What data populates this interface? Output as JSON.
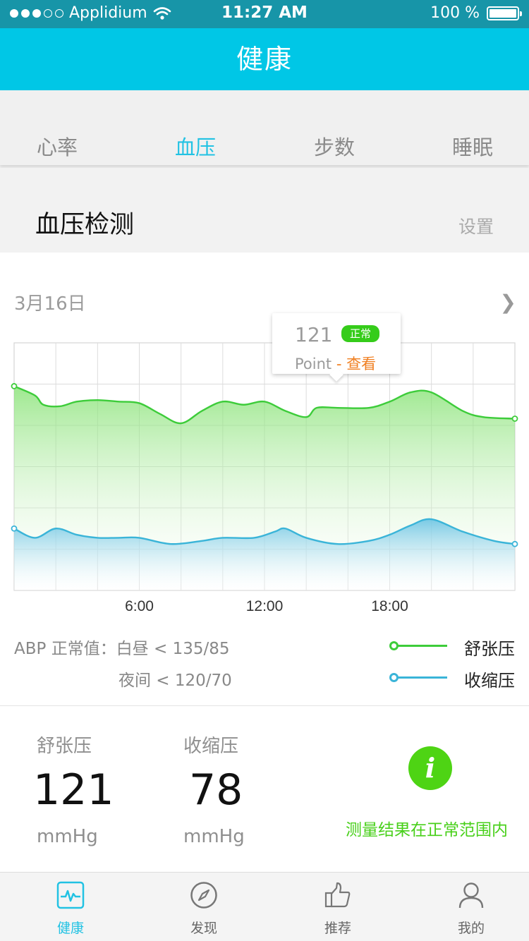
{
  "status_bar": {
    "carrier": "Applidium",
    "time": "11:27 AM",
    "battery": "100 %"
  },
  "nav": {
    "title": "健康"
  },
  "tabs": [
    {
      "label": "心率",
      "active": false
    },
    {
      "label": "血压",
      "active": true
    },
    {
      "label": "步数",
      "active": false
    },
    {
      "label": "睡眠",
      "active": false
    }
  ],
  "section": {
    "title": "血压检测",
    "settings_label": "设置"
  },
  "chart_card": {
    "date": "3月16日",
    "tooltip": {
      "value": "121",
      "badge": "正常",
      "label": "Point",
      "separator": "-",
      "link": "查看"
    }
  },
  "legend": {
    "abp_line1": "ABP 正常值：白昼 < 135/85",
    "abp_line2": "夜间 < 120/70",
    "diastolic": "舒张压",
    "systolic": "收缩压"
  },
  "stats": {
    "diastolic": {
      "title": "舒张压",
      "value": "121",
      "unit": "mmHg"
    },
    "systolic": {
      "title": "收缩压",
      "value": "78",
      "unit": "mmHg"
    },
    "info_icon": "i",
    "result_text": "测量结果在正常范围内"
  },
  "tabbar": [
    {
      "label": "健康",
      "icon": "heartbeat-icon",
      "active": true
    },
    {
      "label": "发现",
      "icon": "compass-icon",
      "active": false
    },
    {
      "label": "推荐",
      "icon": "thumbs-up-icon",
      "active": false
    },
    {
      "label": "我的",
      "icon": "user-icon",
      "active": false
    }
  ],
  "colors": {
    "primary": "#00c7e6",
    "diastolic": "#3dcc3a",
    "systolic": "#3ab4d8",
    "normal": "#35cc1a",
    "link": "#f07f21"
  },
  "chart_data": {
    "type": "area",
    "x_ticks": [
      "6:00",
      "12:00",
      "18:00"
    ],
    "series": [
      {
        "name": "舒张压",
        "color": "#3dcc3a",
        "points": [
          [
            0,
            126
          ],
          [
            1,
            123
          ],
          [
            1.4,
            120
          ],
          [
            2.2,
            119.5
          ],
          [
            3,
            121
          ],
          [
            4,
            121.5
          ],
          [
            5,
            121
          ],
          [
            6,
            120.5
          ],
          [
            7,
            117
          ],
          [
            8,
            114
          ],
          [
            9,
            118
          ],
          [
            10,
            121
          ],
          [
            11,
            120
          ],
          [
            12,
            121
          ],
          [
            13,
            118
          ],
          [
            14,
            116
          ],
          [
            14.5,
            119
          ],
          [
            15.5,
            119
          ],
          [
            17,
            119
          ],
          [
            18,
            121
          ],
          [
            19,
            124
          ],
          [
            20,
            124
          ],
          [
            21.5,
            118
          ],
          [
            22.5,
            116
          ],
          [
            24,
            115.5
          ]
        ]
      },
      {
        "name": "收缩压",
        "color": "#3ab4d8",
        "points": [
          [
            0,
            80
          ],
          [
            1,
            77
          ],
          [
            2,
            80
          ],
          [
            3,
            78
          ],
          [
            4,
            77
          ],
          [
            5,
            77
          ],
          [
            6,
            77
          ],
          [
            7.5,
            75
          ],
          [
            9,
            76
          ],
          [
            10,
            77
          ],
          [
            11.5,
            77
          ],
          [
            12.5,
            79
          ],
          [
            13,
            80
          ],
          [
            14,
            77
          ],
          [
            15.5,
            75
          ],
          [
            17,
            76
          ],
          [
            18,
            78
          ],
          [
            19,
            81
          ],
          [
            20,
            83
          ],
          [
            21.5,
            79
          ],
          [
            23,
            76
          ],
          [
            24,
            75
          ]
        ]
      }
    ],
    "grid": true
  }
}
